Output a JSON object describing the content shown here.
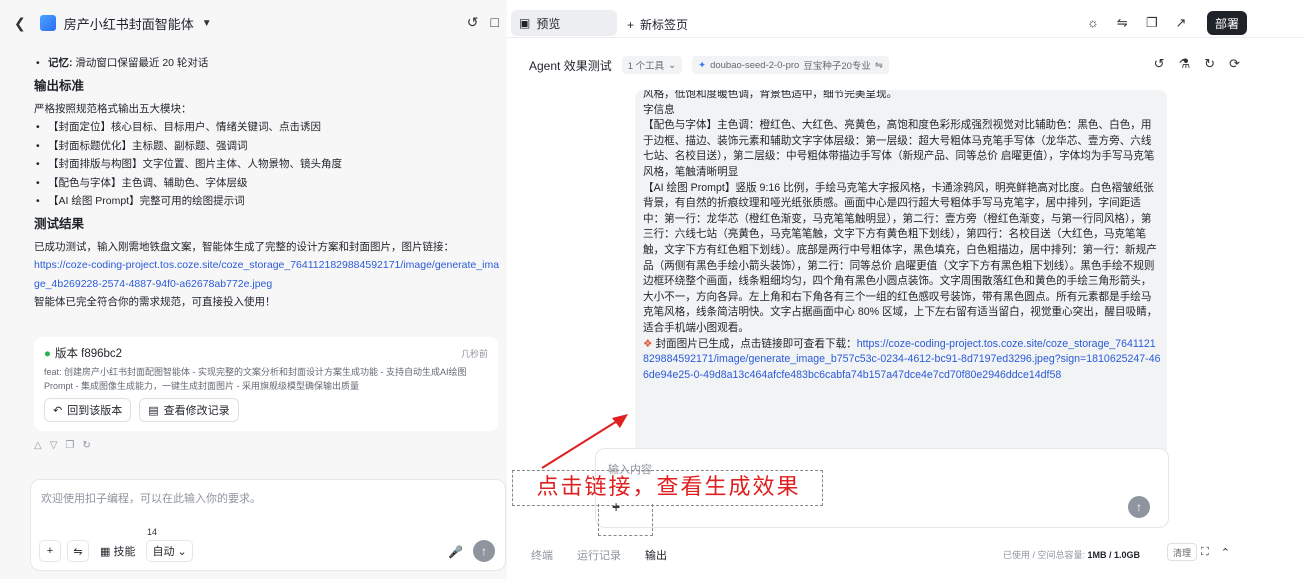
{
  "left": {
    "app_name": "房产小红书封面智能体",
    "memory_label": "记忆:",
    "memory_text": "滑动窗口保留最近 20 轮对话",
    "output_heading": "输出标准",
    "output_intro": "严格按照规范格式输出五大模块：",
    "modules": [
      "【封面定位】核心目标、目标用户、情绪关键词、点击诱因",
      "【封面标题优化】主标题、副标题、强调词",
      "【封面排版与构图】文字位置、图片主体、人物景物、镜头角度",
      "【配色与字体】主色调、辅助色、字体层级",
      "【AI 绘图 Prompt】完整可用的绘图提示词"
    ],
    "test_heading": "测试结果",
    "test_text": "已成功测试，输入刚需地铁盘文案，智能体生成了完整的设计方案和封面图片，图片链接：",
    "test_link": "https://coze-coding-project.tos.coze.site/coze_storage_7641121829884592171/image/generate_image_4b269228-2574-4887-94f0-a62678ab772e.jpeg",
    "test_conclusion": "智能体已完全符合你的需求规范，可直接投入使用！",
    "version": {
      "title": "版本 f896bc2",
      "time": "几秒前",
      "desc": "feat: 创建房产小红书封面配图智能体 - 实现完整的文案分析和封面设计方案生成功能 - 支持自动生成AI绘图Prompt - 集成图像生成能力，一键生成封面图片 - 采用旗舰级模型确保输出质量",
      "revert_label": "回到该版本",
      "history_label": "查看修改记录"
    },
    "input": {
      "placeholder": "欢迎使用扣子编程，可以在此输入你的要求。",
      "skill_label": "技能",
      "skill_count": "14",
      "mode_label": "自动"
    }
  },
  "topbar": {
    "preview_tab": "预览",
    "new_tab": "新标签页",
    "deploy_label": "部署"
  },
  "agent": {
    "title": "Agent 效果测试",
    "tools_chip": "1 个工具",
    "model_name": "doubao-seed-2-0-pro",
    "model_tag": "豆宝种子20专业",
    "message": [
      "风格，低饱和度暖色调，背景色适中，细节完美呈现。",
      "字信息",
      "【配色与字体】主色调：橙红色、大红色、亮黄色，高饱和度色彩形成强烈视觉对比辅助色：黑色、白色，用于边框、描边、装饰元素和辅助文字字体层级：第一层级：超大号粗体马克笔手写体（龙华芯、壹方旁、六线七站、名校目送），第二层级：中号粗体带描边手写体（新规产品、同等总价 启曜更值），字体均为手写马克笔风格，笔触清晰明显",
      "【AI 绘图 Prompt】竖版 9:16 比例，手绘马克笔大字报风格，卡通涂鸦风，明亮鲜艳高对比度。白色褶皱纸张背景，有自然的折痕纹理和哑光纸张质感。画面中心是四行超大号粗体手写马克笔字，居中排列，字间距适中：第一行：龙华芯（橙红色渐变，马克笔笔触明显），第二行：壹方旁（橙红色渐变，与第一行同风格），第三行：六线七站（亮黄色，马克笔笔触，文字下方有黄色粗下划线），第四行：名校目送（大红色，马克笔笔触，文字下方有红色粗下划线）。底部是两行中号粗体字，黑色填充，白色粗描边，居中排列：第一行：新规产品（两侧有黑色手绘小箭头装饰），第二行：同等总价 启曜更值（文字下方有黑色粗下划线）。黑色手绘不规则边框环绕整个画面，线条粗细均匀，四个角有黑色小圆点装饰。文字周围散落红色和黄色的手绘三角形箭头，大小不一，方向各异。左上角和右下角各有三个一组的红色感叹号装饰，带有黑色圆点。所有元素都是手绘马克笔风格，线条简洁明快。文字占据画面中心 80% 区域，上下左右留有适当留白，视觉重心突出，醒目吸睛，适合手机端小图观看。"
    ],
    "generated_prefix": "封面图片已生成，点击链接即可查看下载：",
    "generated_link": "https://coze-coding-project.tos.coze.site/coze_storage_7641121829884592171/image/generate_image_b757c53c-0234-4612-bc91-8d7197ed3296.jpeg?sign=1810625247-466de94e25-0-49d8a13c464afcfe483bc6cabfa74b157a47dce4e7cd70f80e2946ddce14df58",
    "input_placeholder": "输入内容",
    "footer_tabs": [
      "终端",
      "运行记录",
      "输出"
    ],
    "storage_label": "已使用 / 空间总容量:",
    "storage_value": "1MB / 1.0GB",
    "clear_label": "清理"
  },
  "annotation": {
    "text": "点击链接，查看生成效果",
    "color": "#e02020"
  }
}
